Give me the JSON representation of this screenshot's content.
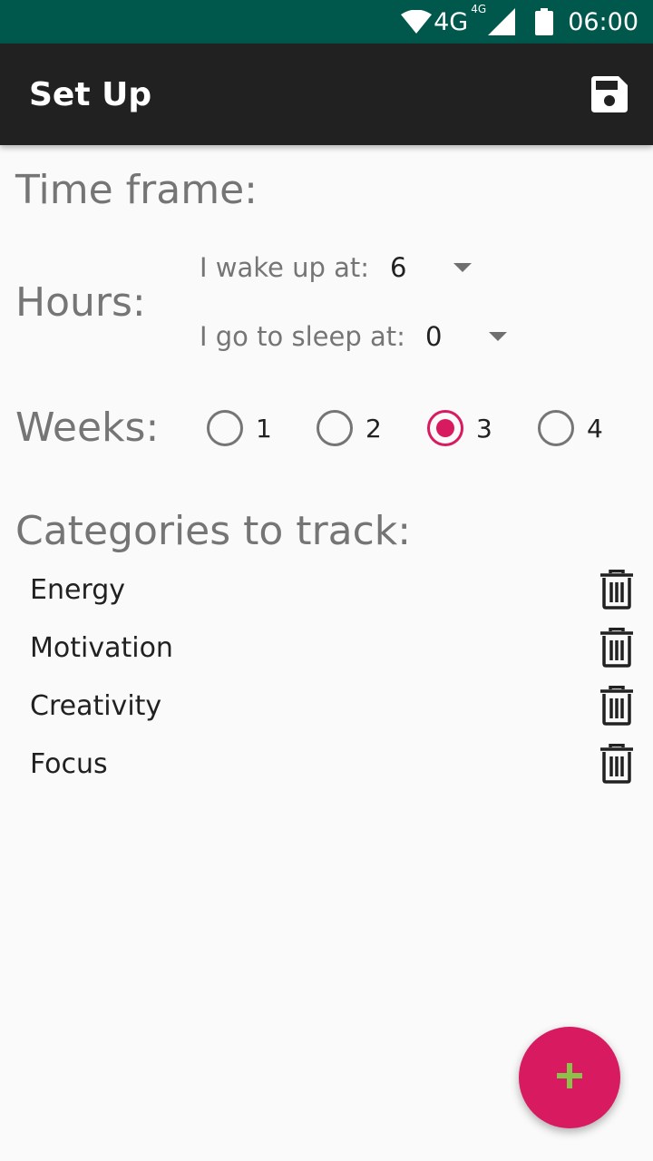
{
  "status_bar": {
    "network": "4G",
    "network_small": "4G",
    "time": "06:00",
    "icons": [
      "wifi-icon",
      "signal-icon",
      "battery-icon"
    ]
  },
  "app_bar": {
    "title": "Set Up",
    "action_icon": "save-icon"
  },
  "time_frame": {
    "title": "Time frame:",
    "hours_label": "Hours:",
    "wake_label": "I wake up at:",
    "wake_value": "6",
    "sleep_label": "I go to sleep at:",
    "sleep_value": "0",
    "weeks_label": "Weeks:",
    "weeks_options": [
      "1",
      "2",
      "3",
      "4"
    ],
    "weeks_selected": "3"
  },
  "categories": {
    "title": "Categories to track:",
    "items": [
      "Energy",
      "Motivation",
      "Creativity",
      "Focus"
    ],
    "delete_icon": "trash-icon"
  },
  "fab": {
    "icon": "plus-icon"
  },
  "colors": {
    "status_bar": "#00574b",
    "app_bar": "#212121",
    "accent": "#d81b60",
    "fab_plus": "#8bc34a",
    "label_gray": "#757575"
  }
}
